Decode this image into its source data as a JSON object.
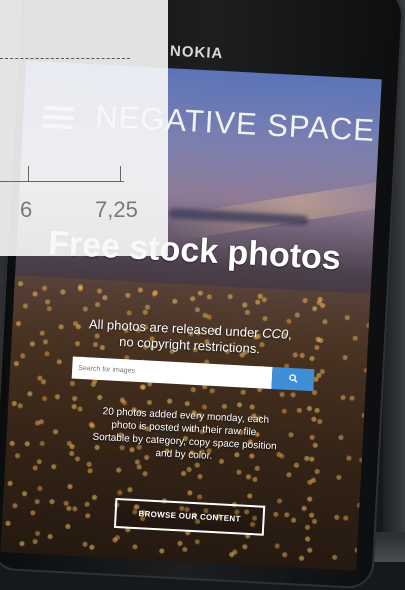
{
  "phone": {
    "brand": "NOKIA"
  },
  "site": {
    "title": "NEGATIVE SPACE",
    "headline": "Free stock photos",
    "subline_pre": "All photos are released under ",
    "subline_license": "CC0",
    "subline_post": ",",
    "subline_2": "no copyright restrictions.",
    "search_placeholder": "Search for images",
    "search_button_icon": "search-icon",
    "info_1": "20 photos added every monday, each",
    "info_2": "photo is posted with their raw file.",
    "info_3": "Sortable by category, copy space position",
    "info_4": "and by color.",
    "browse_label": "BROWSE OUR CONTENT"
  },
  "overlay": {
    "tick_a_label": "6",
    "tick_b_label": "7,25"
  }
}
